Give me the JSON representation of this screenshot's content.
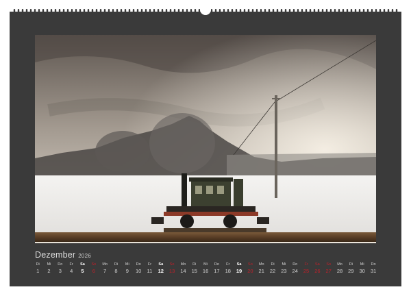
{
  "calendar": {
    "month": "Dezember",
    "year": "2026",
    "days": [
      {
        "wd": "Di",
        "num": "1",
        "type": "weekday"
      },
      {
        "wd": "Mi",
        "num": "2",
        "type": "weekday"
      },
      {
        "wd": "Do",
        "num": "3",
        "type": "weekday"
      },
      {
        "wd": "Fr",
        "num": "4",
        "type": "weekday"
      },
      {
        "wd": "Sa",
        "num": "5",
        "type": "sat"
      },
      {
        "wd": "So",
        "num": "6",
        "type": "sun"
      },
      {
        "wd": "Mo",
        "num": "7",
        "type": "weekday"
      },
      {
        "wd": "Di",
        "num": "8",
        "type": "weekday"
      },
      {
        "wd": "Mi",
        "num": "9",
        "type": "weekday"
      },
      {
        "wd": "Do",
        "num": "10",
        "type": "weekday"
      },
      {
        "wd": "Fr",
        "num": "11",
        "type": "weekday"
      },
      {
        "wd": "Sa",
        "num": "12",
        "type": "sat"
      },
      {
        "wd": "So",
        "num": "13",
        "type": "sun"
      },
      {
        "wd": "Mo",
        "num": "14",
        "type": "weekday"
      },
      {
        "wd": "Di",
        "num": "15",
        "type": "weekday"
      },
      {
        "wd": "Mi",
        "num": "16",
        "type": "weekday"
      },
      {
        "wd": "Do",
        "num": "17",
        "type": "weekday"
      },
      {
        "wd": "Fr",
        "num": "18",
        "type": "weekday"
      },
      {
        "wd": "Sa",
        "num": "19",
        "type": "sat"
      },
      {
        "wd": "So",
        "num": "20",
        "type": "sun"
      },
      {
        "wd": "Mo",
        "num": "21",
        "type": "weekday"
      },
      {
        "wd": "Di",
        "num": "22",
        "type": "weekday"
      },
      {
        "wd": "Mi",
        "num": "23",
        "type": "weekday"
      },
      {
        "wd": "Do",
        "num": "24",
        "type": "weekday"
      },
      {
        "wd": "Fr",
        "num": "25",
        "type": "sun"
      },
      {
        "wd": "Sa",
        "num": "26",
        "type": "sun"
      },
      {
        "wd": "So",
        "num": "27",
        "type": "sun"
      },
      {
        "wd": "Mo",
        "num": "28",
        "type": "weekday"
      },
      {
        "wd": "Di",
        "num": "29",
        "type": "weekday"
      },
      {
        "wd": "Mi",
        "num": "30",
        "type": "weekday"
      },
      {
        "wd": "Do",
        "num": "31",
        "type": "weekday"
      }
    ]
  },
  "photo": {
    "subject": "steam-locomotive-photo"
  },
  "colors": {
    "background": "#3a3a3a",
    "text": "#d6d6d6",
    "saturday": "#ffffff",
    "holiday": "#c0202a"
  }
}
